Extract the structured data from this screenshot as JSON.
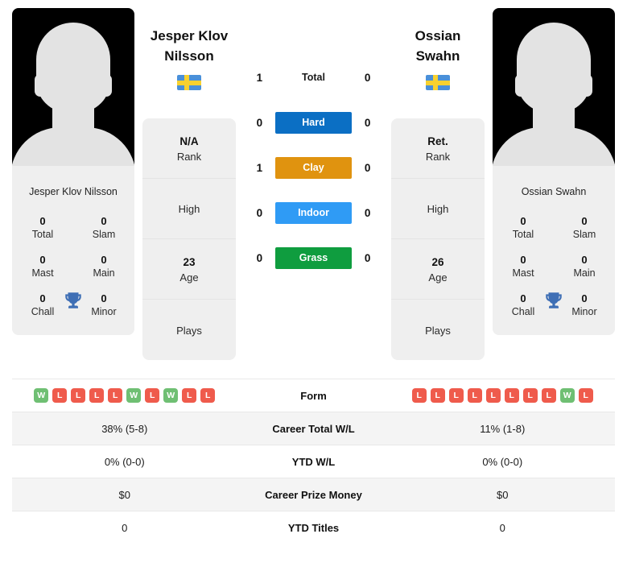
{
  "players": {
    "left": {
      "display_name": "Jesper Klov Nilsson",
      "name_line1": "Jesper Klov",
      "name_line2": "Nilsson",
      "photo_caption": "Jesper Klov Nilsson",
      "flag": "sweden-flag",
      "rank_value": "N/A",
      "rank_label": "Rank",
      "high_label": "High",
      "high_value": "",
      "age_value": "23",
      "age_label": "Age",
      "plays_label": "Plays",
      "plays_value": "",
      "titles": [
        {
          "value": "0",
          "label": "Total"
        },
        {
          "value": "0",
          "label": "Slam"
        },
        {
          "value": "0",
          "label": "Mast"
        },
        {
          "value": "0",
          "label": "Main"
        },
        {
          "value": "0",
          "label": "Chall"
        },
        {
          "value": "0",
          "label": "Minor"
        }
      ],
      "form": [
        "W",
        "L",
        "L",
        "L",
        "L",
        "W",
        "L",
        "W",
        "L",
        "L"
      ],
      "career_total_wl": "38% (5-8)",
      "ytd_wl": "0% (0-0)",
      "career_prize_money": "$0",
      "ytd_titles": "0"
    },
    "right": {
      "display_name": "Ossian Swahn",
      "name_line1": "Ossian",
      "name_line2": "Swahn",
      "photo_caption": "Ossian Swahn",
      "flag": "sweden-flag",
      "rank_value": "Ret.",
      "rank_label": "Rank",
      "high_label": "High",
      "high_value": "",
      "age_value": "26",
      "age_label": "Age",
      "plays_label": "Plays",
      "plays_value": "",
      "titles": [
        {
          "value": "0",
          "label": "Total"
        },
        {
          "value": "0",
          "label": "Slam"
        },
        {
          "value": "0",
          "label": "Mast"
        },
        {
          "value": "0",
          "label": "Main"
        },
        {
          "value": "0",
          "label": "Chall"
        },
        {
          "value": "0",
          "label": "Minor"
        }
      ],
      "form": [
        "L",
        "L",
        "L",
        "L",
        "L",
        "L",
        "L",
        "L",
        "W",
        "L"
      ],
      "career_total_wl": "11% (1-8)",
      "ytd_wl": "0% (0-0)",
      "career_prize_money": "$0",
      "ytd_titles": "0"
    }
  },
  "head_to_head": {
    "rows": [
      {
        "label": "Total",
        "left": "1",
        "right": "0",
        "style": "plain",
        "color": ""
      },
      {
        "label": "Hard",
        "left": "0",
        "right": "0",
        "style": "bar",
        "color": "#0b6fc4"
      },
      {
        "label": "Clay",
        "left": "1",
        "right": "0",
        "style": "bar",
        "color": "#e0930f"
      },
      {
        "label": "Indoor",
        "left": "0",
        "right": "0",
        "style": "bar",
        "color": "#2f9bf5"
      },
      {
        "label": "Grass",
        "left": "0",
        "right": "0",
        "style": "bar",
        "color": "#0f9d3f"
      }
    ]
  },
  "comparison_table": {
    "rows": [
      {
        "label": "Form",
        "type": "form",
        "left": "",
        "right": ""
      },
      {
        "label": "Career Total W/L",
        "type": "text",
        "left": "38% (5-8)",
        "right": "11% (1-8)"
      },
      {
        "label": "YTD W/L",
        "type": "text",
        "left": "0% (0-0)",
        "right": "0% (0-0)"
      },
      {
        "label": "Career Prize Money",
        "type": "text",
        "left": "$0",
        "right": "$0"
      },
      {
        "label": "YTD Titles",
        "type": "text",
        "left": "0",
        "right": "0"
      }
    ]
  },
  "colors": {
    "win": "#6fbf73",
    "loss": "#ef5b4c",
    "card_bg": "#efefef",
    "row_alt": "#f4f4f4",
    "trophy": "#3f6fb5"
  }
}
